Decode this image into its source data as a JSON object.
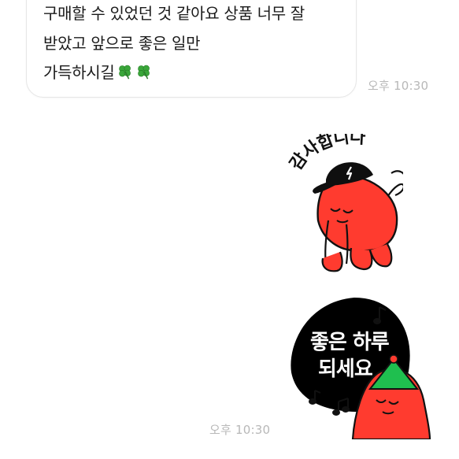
{
  "chat": {
    "incoming_message": {
      "lines": [
        "구매할 수 있었던 것 같아요 상품 너무 잘",
        "받았고 앞으로 좋은 일만",
        "가득하시길"
      ],
      "emoji": [
        "four-leaf-clover",
        "four-leaf-clover"
      ],
      "time": "오후 10:30"
    },
    "sticker_1": {
      "text": "감사합니다",
      "description_icon": "red-character-bowing-with-cap"
    },
    "sticker_2": {
      "line1": "좋은 하루",
      "line2": "되세요",
      "description_icon": "red-character-party-hat-music-notes",
      "time": "오후 10:30"
    }
  },
  "colors": {
    "bubble_border": "#e6e6e6",
    "timestamp": "#b8b8b8",
    "character_red": "#ff3b2f",
    "party_hat_green": "#1fbf4f",
    "sticker_black": "#000000"
  }
}
